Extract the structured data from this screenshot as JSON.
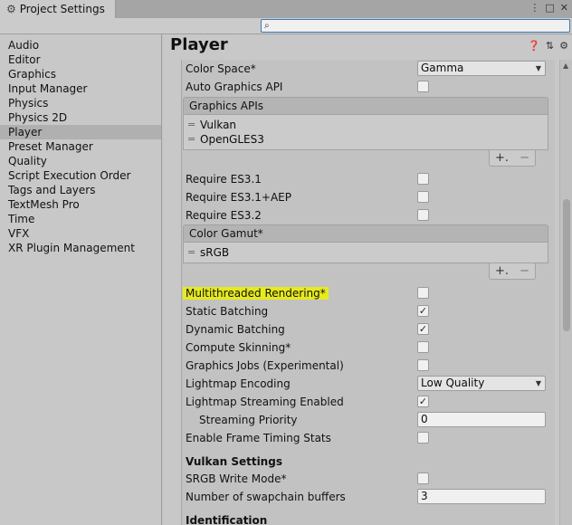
{
  "window": {
    "tab_title": "Project Settings",
    "tab_icon": "gear-icon",
    "menu_glyph": "⋮",
    "maximize_glyph": "□",
    "close_glyph": "✕"
  },
  "search": {
    "placeholder": "",
    "value": ""
  },
  "sidebar": {
    "items": [
      {
        "label": "Audio"
      },
      {
        "label": "Editor"
      },
      {
        "label": "Graphics"
      },
      {
        "label": "Input Manager"
      },
      {
        "label": "Physics"
      },
      {
        "label": "Physics 2D"
      },
      {
        "label": "Player",
        "selected": true
      },
      {
        "label": "Preset Manager"
      },
      {
        "label": "Quality"
      },
      {
        "label": "Script Execution Order"
      },
      {
        "label": "Tags and Layers"
      },
      {
        "label": "TextMesh Pro"
      },
      {
        "label": "Time"
      },
      {
        "label": "VFX"
      },
      {
        "label": "XR Plugin Management"
      }
    ]
  },
  "main": {
    "title": "Player",
    "header_icons": [
      "help-icon",
      "presets-icon",
      "settings-icon"
    ],
    "color_space": {
      "label": "Color Space*",
      "value": "Gamma"
    },
    "auto_graphics_api": {
      "label": "Auto Graphics API",
      "checked": false
    },
    "graphics_apis": {
      "header": "Graphics APIs",
      "items": [
        "Vulkan",
        "OpenGLES3"
      ]
    },
    "require_es31": {
      "label": "Require ES3.1",
      "checked": false
    },
    "require_es31_aep": {
      "label": "Require ES3.1+AEP",
      "checked": false
    },
    "require_es32": {
      "label": "Require ES3.2",
      "checked": false
    },
    "color_gamut": {
      "header": "Color Gamut*",
      "items": [
        "sRGB"
      ]
    },
    "multithreaded_rendering": {
      "label": "Multithreaded Rendering*",
      "checked": false
    },
    "static_batching": {
      "label": "Static Batching",
      "checked": true
    },
    "dynamic_batching": {
      "label": "Dynamic Batching",
      "checked": true
    },
    "compute_skinning": {
      "label": "Compute Skinning*",
      "checked": false
    },
    "graphics_jobs": {
      "label": "Graphics Jobs (Experimental)",
      "checked": false
    },
    "lightmap_encoding": {
      "label": "Lightmap Encoding",
      "value": "Low Quality"
    },
    "lightmap_streaming": {
      "label": "Lightmap Streaming Enabled",
      "checked": true
    },
    "streaming_priority": {
      "label": "Streaming Priority",
      "value": "0"
    },
    "frame_timing_stats": {
      "label": "Enable Frame Timing Stats",
      "checked": false
    },
    "vulkan_settings": {
      "heading": "Vulkan Settings"
    },
    "srgb_write_mode": {
      "label": "SRGB Write Mode*",
      "checked": false
    },
    "swapchain_buffers": {
      "label": "Number of swapchain buffers",
      "value": "3"
    },
    "identification": {
      "heading": "Identification"
    },
    "list_add": "+.",
    "list_remove": "−",
    "list_handle": "=",
    "check_glyph": "✓",
    "dropdown_arrow": "▼"
  },
  "colors": {
    "highlight": "#e6ea1e",
    "selected_item": "#b0b0b0",
    "search_border": "#3b79b8"
  }
}
